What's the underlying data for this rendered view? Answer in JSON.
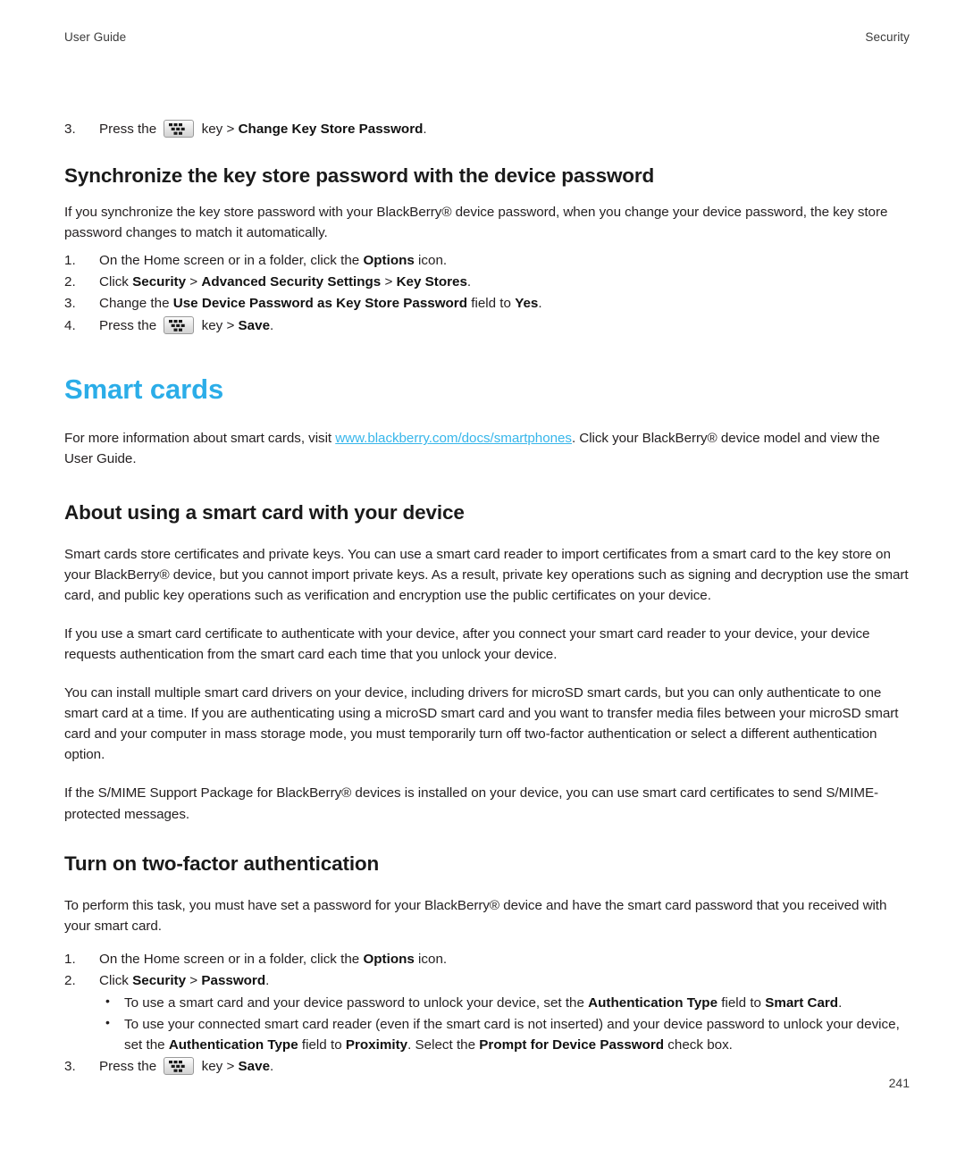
{
  "header": {
    "left": "User Guide",
    "right": "Security"
  },
  "top_step": {
    "number": "3.",
    "before": "Press the",
    "middle": "key >",
    "bold": "Change Key Store Password",
    "after": "."
  },
  "section_sync": {
    "heading": "Synchronize the key store password with the device password",
    "intro": "If you synchronize the key store password with your BlackBerry® device password, when you change your device password, the key store password changes to match it automatically.",
    "steps": [
      {
        "number": "1.",
        "parts": [
          {
            "t": "On the Home screen or in a folder, click the ",
            "b": false
          },
          {
            "t": "Options",
            "b": true
          },
          {
            "t": " icon.",
            "b": false
          }
        ]
      },
      {
        "number": "2.",
        "parts": [
          {
            "t": "Click ",
            "b": false
          },
          {
            "t": "Security",
            "b": true
          },
          {
            "t": " > ",
            "b": false
          },
          {
            "t": "Advanced Security Settings",
            "b": true
          },
          {
            "t": " > ",
            "b": false
          },
          {
            "t": "Key Stores",
            "b": true
          },
          {
            "t": ".",
            "b": false
          }
        ]
      },
      {
        "number": "3.",
        "parts": [
          {
            "t": "Change the ",
            "b": false
          },
          {
            "t": "Use Device Password as Key Store Password",
            "b": true
          },
          {
            "t": " field to ",
            "b": false
          },
          {
            "t": "Yes",
            "b": true
          },
          {
            "t": ".",
            "b": false
          }
        ]
      },
      {
        "number": "4.",
        "key_step": true,
        "before": "Press the",
        "middle": "key >",
        "bold": "Save",
        "after": "."
      }
    ]
  },
  "chapter": {
    "title": "Smart cards",
    "intro_before": "For more information about smart cards, visit ",
    "link": "www.blackberry.com/docs/smartphones",
    "intro_after": ". Click your BlackBerry® device model and view the User Guide."
  },
  "section_about": {
    "heading": "About using a smart card with your device",
    "paragraphs": [
      "Smart cards store certificates and private keys. You can use a smart card reader to import certificates from a smart card to the key store on your BlackBerry® device, but you cannot import private keys. As a result, private key operations such as signing and decryption use the smart card, and public key operations such as verification and encryption use the public certificates on your device.",
      "If you use a smart card certificate to authenticate with your device, after you connect your smart card reader to your device, your device requests authentication from the smart card each time that you unlock your device.",
      "You can install multiple smart card drivers on your device, including drivers for microSD smart cards, but you can only authenticate to one smart card at a time. If you are authenticating using a microSD smart card and you want to transfer media files between your microSD smart card and your computer in mass storage mode, you must temporarily turn off two-factor authentication or select a different authentication option.",
      "If the S/MIME Support Package for BlackBerry® devices is installed on your device, you can use smart card certificates to send S/MIME-protected messages."
    ]
  },
  "section_twofactor": {
    "heading": "Turn on two-factor authentication",
    "intro": "To perform this task, you must have set a password for your BlackBerry® device and have the smart card password that you received with your smart card.",
    "steps": [
      {
        "number": "1.",
        "parts": [
          {
            "t": "On the Home screen or in a folder, click the ",
            "b": false
          },
          {
            "t": "Options",
            "b": true
          },
          {
            "t": " icon.",
            "b": false
          }
        ]
      },
      {
        "number": "2.",
        "parts": [
          {
            "t": "Click ",
            "b": false
          },
          {
            "t": "Security",
            "b": true
          },
          {
            "t": " > ",
            "b": false
          },
          {
            "t": "Password",
            "b": true
          },
          {
            "t": ".",
            "b": false
          }
        ]
      },
      {
        "number": "3.",
        "key_step": true,
        "before": "Press the",
        "middle": "key >",
        "bold": "Save",
        "after": "."
      }
    ],
    "bullets": [
      [
        {
          "t": "To use a smart card and your device password to unlock your device, set the ",
          "b": false
        },
        {
          "t": "Authentication Type",
          "b": true
        },
        {
          "t": " field to ",
          "b": false
        },
        {
          "t": "Smart Card",
          "b": true
        },
        {
          "t": ".",
          "b": false
        }
      ],
      [
        {
          "t": "To use your connected smart card reader (even if the smart card is not inserted) and your device password to unlock your device, set the ",
          "b": false
        },
        {
          "t": "Authentication Type",
          "b": true
        },
        {
          "t": " field to ",
          "b": false
        },
        {
          "t": "Proximity",
          "b": true
        },
        {
          "t": ". Select the ",
          "b": false
        },
        {
          "t": "Prompt for Device Password",
          "b": true
        },
        {
          "t": " check box.",
          "b": false
        }
      ]
    ]
  },
  "footer": {
    "page_number": "241"
  },
  "icons": {
    "menu_key": "blackberry-menu-key-icon",
    "bullet": "•"
  },
  "colors": {
    "accent": "#2bade8",
    "link": "#37b6ea",
    "text": "#231f20"
  }
}
